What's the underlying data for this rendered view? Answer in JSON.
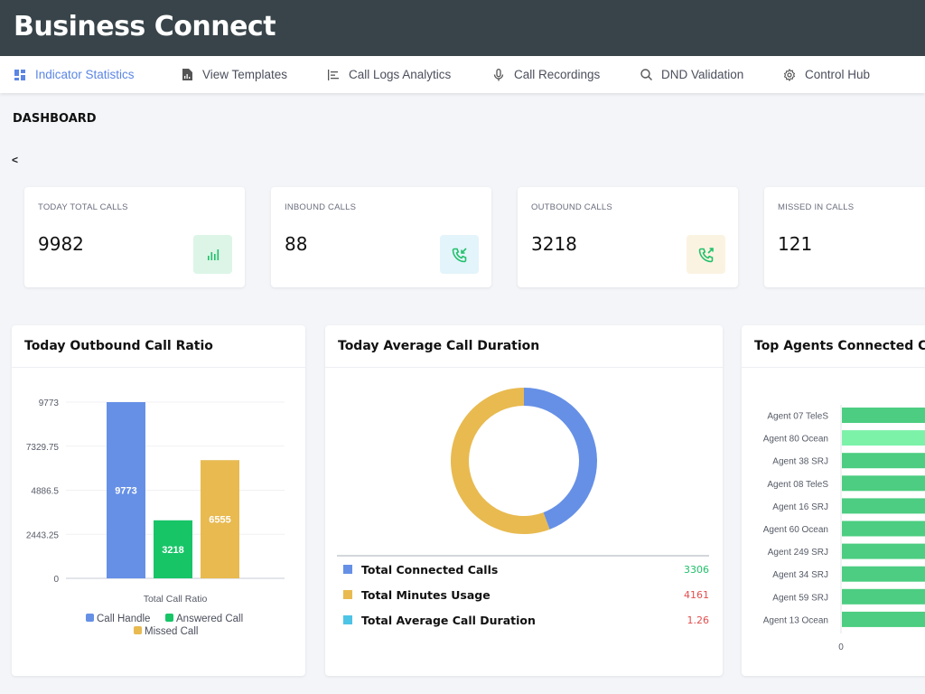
{
  "app": {
    "title": "Business Connect"
  },
  "nav": {
    "items": [
      {
        "label": "Indicator Statistics",
        "icon": "dashboard-grid-icon",
        "active": true
      },
      {
        "label": "View Templates",
        "icon": "document-chart-icon",
        "active": false
      },
      {
        "label": "Call Logs Analytics",
        "icon": "bar-list-icon",
        "active": false
      },
      {
        "label": "Call Recordings",
        "icon": "microphone-icon",
        "active": false
      },
      {
        "label": "DND Validation",
        "icon": "search-icon",
        "active": false
      },
      {
        "label": "Control Hub",
        "icon": "gear-icon",
        "active": false
      }
    ]
  },
  "page": {
    "title": "DASHBOARD",
    "back_label": "<"
  },
  "stats": [
    {
      "label": "TODAY TOTAL CALLS",
      "value": "9982",
      "icon": "bar-chart-icon",
      "icon_bg": "#dcf5e7",
      "icon_color": "#22c06b"
    },
    {
      "label": "INBOUND CALLS",
      "value": "88",
      "icon": "phone-incoming-icon",
      "icon_bg": "#e3f4fb",
      "icon_color": "#22c06b"
    },
    {
      "label": "OUTBOUND CALLS",
      "value": "3218",
      "icon": "phone-outgoing-icon",
      "icon_bg": "#fbf3e2",
      "icon_color": "#22c06b"
    },
    {
      "label": "MISSED IN CALLS",
      "value": "121",
      "icon": "phone-missed-icon",
      "icon_bg": "#fde7e7",
      "icon_color": "#e44d4d"
    }
  ],
  "panels": {
    "outbound_ratio": {
      "title": "Today Outbound Call Ratio"
    },
    "avg_duration": {
      "title": "Today Average Call Duration"
    },
    "top_agents": {
      "title": "Top Agents Connected Ca"
    }
  },
  "chart_data": [
    {
      "type": "bar",
      "title": "Today Outbound Call Ratio",
      "xlabel": "Total Call Ratio",
      "ylabel": "",
      "categories": [
        "Total Call Ratio"
      ],
      "series": [
        {
          "name": "Call Handle",
          "values": [
            9773
          ],
          "color": "#6690e6"
        },
        {
          "name": "Answered Call",
          "values": [
            3218
          ],
          "color": "#17c567"
        },
        {
          "name": "Missed Call",
          "values": [
            6555
          ],
          "color": "#e8ba50"
        }
      ],
      "yticks": [
        "0",
        "2443.25",
        "4886.5",
        "7329.75",
        "9773"
      ],
      "ylim": [
        0,
        9773
      ],
      "grid": true,
      "legend": "bottom"
    },
    {
      "type": "pie",
      "title": "Today Average Call Duration",
      "donut": true,
      "slices": [
        {
          "name": "Total Connected Calls",
          "value": 3306,
          "color": "#6690e6",
          "value_color": "#22c06b"
        },
        {
          "name": "Total Minutes Usage",
          "value": 4161,
          "color": "#e8ba50",
          "value_color": "#e44d4d"
        },
        {
          "name": "Total Average Call Duration",
          "value": 1.26,
          "color": "#4dc4e6",
          "value_color": "#e44d4d"
        }
      ],
      "legend": "bottom"
    },
    {
      "type": "bar",
      "orientation": "horizontal",
      "title": "Top Agents Connected Ca",
      "categories": [
        "Agent 07 TeleS",
        "Agent 80 Ocean",
        "Agent 38 SRJ",
        "Agent 08 TeleS",
        "Agent 16 SRJ",
        "Agent 60 Ocean",
        "Agent 249 SRJ",
        "Agent 34 SRJ",
        "Agent 59 SRJ",
        "Agent 13 Ocean"
      ],
      "bar_colors": [
        "#4ccd81",
        "#7cf2a8",
        "#4ccd81",
        "#4ccd81",
        "#4ccd81",
        "#4ccd81",
        "#4ccd81",
        "#4ccd81",
        "#4ccd81",
        "#4ccd81"
      ],
      "xticks": [
        "0"
      ],
      "grid": true
    }
  ]
}
